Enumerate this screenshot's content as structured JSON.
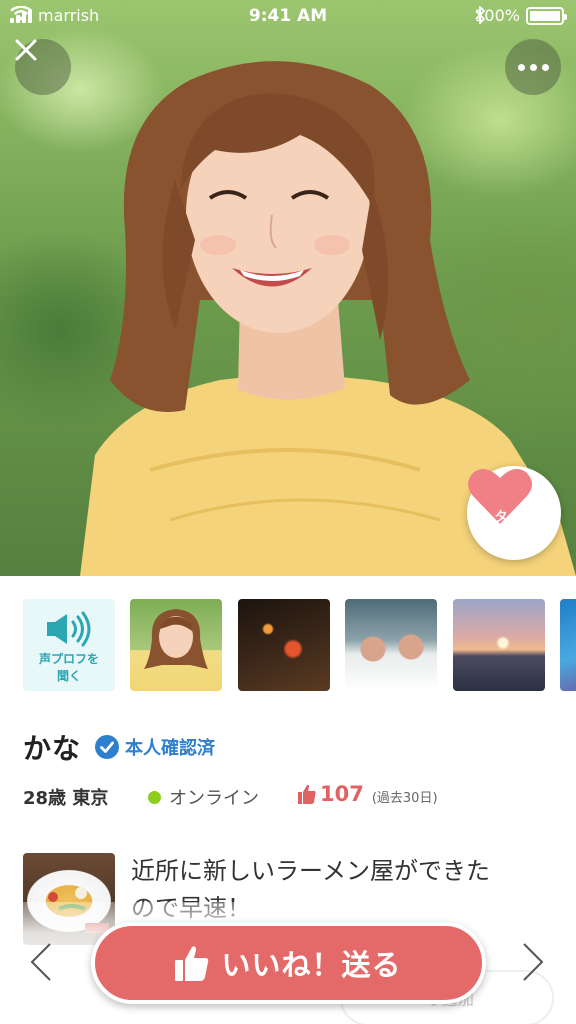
{
  "status_bar": {
    "carrier": "marrish",
    "time": "9:41 AM",
    "battery": "100%"
  },
  "header": {
    "close_icon": "close-icon",
    "more_icon": "more-icon"
  },
  "type_button": {
    "label": "タイプ",
    "color": "#f07f86"
  },
  "thumbnails": {
    "voice_label_line1": "声プロフを",
    "voice_label_line2": "聞く",
    "items": [
      "profile-photo",
      "night-lanterns-photo",
      "snow-monkeys-photo",
      "sunset-sea-photo",
      "coral-reef-photo"
    ]
  },
  "profile": {
    "name": "かな",
    "verified_label": "本人確認済",
    "age_location": "28歳 東京",
    "status": "オンライン",
    "likes_count": "107",
    "likes_period": "(過去30日)"
  },
  "post": {
    "text_line1": "近所に新しいラーメン屋ができた",
    "text_line2": "ので早速！"
  },
  "footer": {
    "like_button_label": "いいね！送る",
    "secondary_label": "り追加"
  },
  "colors": {
    "accent_red": "#e46a6a",
    "verified_blue": "#2f7fcf",
    "online_green": "#8ccd1e",
    "voice_teal": "#2ba6b3"
  }
}
